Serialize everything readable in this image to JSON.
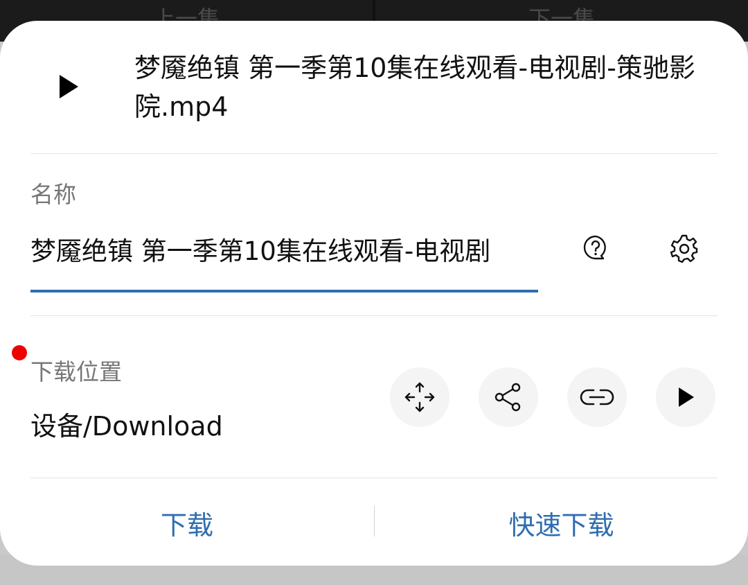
{
  "background": {
    "prev_label": "上一集",
    "next_label": "下一集"
  },
  "dialog": {
    "file_title": "梦魇绝镇 第一季第10集在线观看-电视剧-策驰影院.mp4",
    "play_icon": "play-icon",
    "name_label": "名称",
    "name_value": "梦魇绝镇 第一季第10集在线观看-电视剧",
    "help_icon": "question-bubble-icon",
    "settings_icon": "gear-icon",
    "location_label": "下载位置",
    "location_value": "设备/Download",
    "location_icons": [
      "move-arrows-icon",
      "share-icon",
      "link-icon",
      "play-icon"
    ],
    "download_label": "下载",
    "fast_download_label": "快速下载"
  },
  "colors": {
    "accent": "#2f6db0",
    "notification_dot": "#ee0000"
  }
}
